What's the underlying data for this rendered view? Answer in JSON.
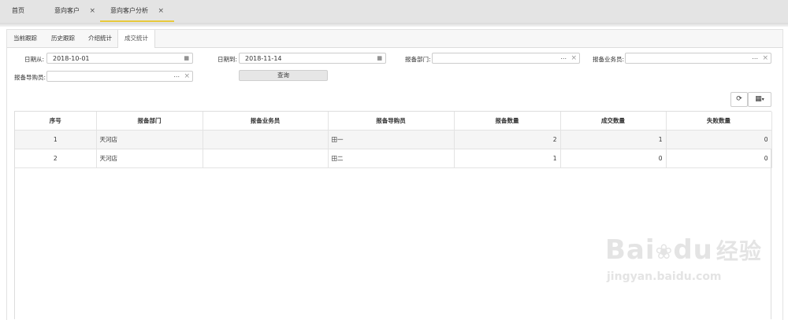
{
  "top_tabs": [
    {
      "label": "首页",
      "closable": false
    },
    {
      "label": "意向客户",
      "closable": true
    },
    {
      "label": "意向客户分析",
      "closable": true,
      "active": true
    }
  ],
  "close_glyph": "×",
  "sub_tabs": [
    {
      "label": "当前跟踪"
    },
    {
      "label": "历史跟踪"
    },
    {
      "label": "介绍统计"
    },
    {
      "label": "成交统计",
      "active": true
    }
  ],
  "filters": {
    "date_from_label": "日期从:",
    "date_from_value": "2018-10-01",
    "date_to_label": "日期到:",
    "date_to_value": "2018-11-14",
    "dept_label": "报备部门:",
    "dept_value": "",
    "salesman_label": "报备业务员:",
    "salesman_value": "",
    "guide_label": "报备导购员:",
    "guide_value": "",
    "ellipsis": "...",
    "clear_glyph": "×",
    "query_button": "查询"
  },
  "toolbar": {
    "refresh_icon": "refresh-icon",
    "columns_icon": "columns-icon"
  },
  "table": {
    "headers": [
      "序号",
      "报备部门",
      "报备业务员",
      "报备导购员",
      "报备数量",
      "成交数量",
      "失败数量"
    ],
    "rows": [
      [
        "1",
        "天河店",
        "",
        "田一",
        "2",
        "1",
        "0"
      ],
      [
        "2",
        "天河店",
        "",
        "田二",
        "1",
        "0",
        "0"
      ]
    ]
  },
  "watermark": {
    "brand": "Bai",
    "brand2": "du",
    "cn": "经验",
    "url": "jingyan.baidu.com"
  }
}
